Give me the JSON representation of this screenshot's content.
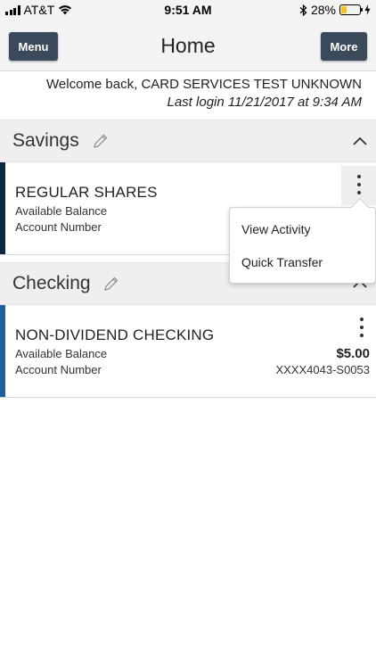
{
  "status_bar": {
    "carrier": "AT&T",
    "time": "9:51 AM",
    "battery_percent": "28%",
    "battery_level": 0.28
  },
  "nav": {
    "menu_label": "Menu",
    "title": "Home",
    "more_label": "More"
  },
  "welcome": {
    "greeting": "Welcome back, CARD SERVICES TEST UNKNOWN",
    "last_login": "Last login 11/21/2017 at 9:34 AM"
  },
  "sections": [
    {
      "title": "Savings",
      "accounts": [
        {
          "name": "REGULAR SHARES",
          "balance_label": "Available Balance",
          "number_label": "Account Number",
          "accent": "#0e2740"
        }
      ]
    },
    {
      "title": "Checking",
      "accounts": [
        {
          "name": "NON-DIVIDEND CHECKING",
          "balance_label": "Available Balance",
          "number_label": "Account Number",
          "balance": "$5.00",
          "number": "XXXX4043-S0053",
          "accent": "#1f5f9e"
        }
      ]
    }
  ],
  "dropdown": {
    "items": [
      "View Activity",
      "Quick Transfer"
    ]
  },
  "colors": {
    "nav_button": "#3b4a5a",
    "header_bg": "#efefef",
    "battery": "#f5c518"
  }
}
